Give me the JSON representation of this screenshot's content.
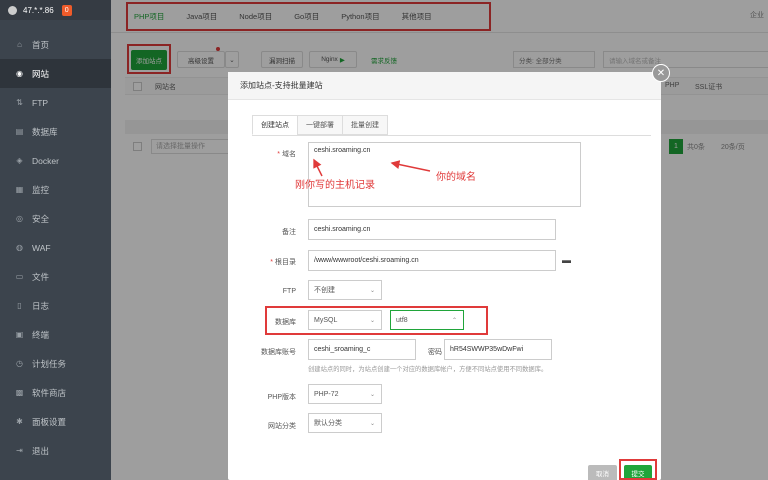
{
  "sidebar": {
    "ip": "47.*.*.86",
    "badge": "0",
    "items": [
      {
        "label": "首页",
        "icon": "home-icon",
        "glyph": "⌂"
      },
      {
        "label": "网站",
        "icon": "globe-icon",
        "glyph": "◉"
      },
      {
        "label": "FTP",
        "icon": "ftp-icon",
        "glyph": "⇅"
      },
      {
        "label": "数据库",
        "icon": "database-icon",
        "glyph": "▤"
      },
      {
        "label": "Docker",
        "icon": "docker-icon",
        "glyph": "◈"
      },
      {
        "label": "监控",
        "icon": "monitor-icon",
        "glyph": "▦"
      },
      {
        "label": "安全",
        "icon": "shield-icon",
        "glyph": "◎"
      },
      {
        "label": "WAF",
        "icon": "waf-icon",
        "glyph": "◍"
      },
      {
        "label": "文件",
        "icon": "folder-icon",
        "glyph": "▭"
      },
      {
        "label": "日志",
        "icon": "log-icon",
        "glyph": "▯"
      },
      {
        "label": "终端",
        "icon": "terminal-icon",
        "glyph": "▣"
      },
      {
        "label": "计划任务",
        "icon": "clock-icon",
        "glyph": "◷"
      },
      {
        "label": "软件商店",
        "icon": "store-icon",
        "glyph": "▩"
      },
      {
        "label": "面板设置",
        "icon": "gear-icon",
        "glyph": "✱"
      },
      {
        "label": "退出",
        "icon": "logout-icon",
        "glyph": "⇥"
      }
    ]
  },
  "project_tabs": [
    "PHP项目",
    "Java项目",
    "Node项目",
    "Go项目",
    "Python项目",
    "其他项目"
  ],
  "topbar_right": "企业",
  "toolbar": {
    "add_site": "添加站点",
    "advanced": "高级设置",
    "scan": "漏洞扫描",
    "nginx": "Nginx",
    "feedback": "需求反馈",
    "category": "分类: 全部分类",
    "search_placeholder": "请输入域名或备注"
  },
  "table": {
    "col_site": "网站名",
    "col_php": "PHP",
    "col_ssl": "SSL证书",
    "batch_placeholder": "请选择批量操作",
    "page": "1",
    "total": "共0条",
    "per_page": "20条/页"
  },
  "modal": {
    "title": "添加站点-支持批量建站",
    "tabs": [
      "创建站点",
      "一键部署",
      "批量创建"
    ],
    "domain_label": "域名",
    "domain_value": "ceshi.sroaming.cn",
    "remark_label": "备注",
    "remark_value": "ceshi.sroaming.cn",
    "root_label": "根目录",
    "root_value": "/www/wwwroot/ceshi.sroaming.cn",
    "ftp_label": "FTP",
    "ftp_value": "不创建",
    "db_label": "数据库",
    "db_type": "MySQL",
    "db_charset": "utf8",
    "db_account_label": "数据库账号",
    "db_account_value": "ceshi_sroaming_c",
    "password_label": "密码",
    "password_value": "hR54SWWP35wDwFwi",
    "db_hint": "创建站点的同时，为站点创建一个对应的数据库帐户，方便不同站点使用不同数据库。",
    "php_label": "PHP版本",
    "php_value": "PHP-72",
    "category_label": "网站分类",
    "category_value": "默认分类",
    "cancel": "取消",
    "submit": "提交"
  },
  "annotations": {
    "host_record": "刚你写的主机记录",
    "your_domain": "你的域名"
  },
  "accent_color": "#20a53a",
  "highlight_color": "#e03a3a"
}
